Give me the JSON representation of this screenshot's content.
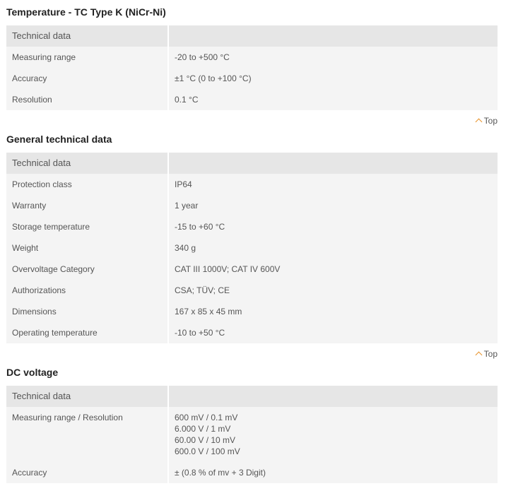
{
  "sections": [
    {
      "title": "Temperature - TC Type K (NiCr-Ni)",
      "header": {
        "label": "Technical data",
        "value": ""
      },
      "rows": [
        {
          "label": "Measuring range",
          "value": "-20 to +500 °C"
        },
        {
          "label": "Accuracy",
          "value": "±1 °C (0 to +100 °C)"
        },
        {
          "label": "Resolution",
          "value": "0.1 °C"
        }
      ],
      "top_label": "Top"
    },
    {
      "title": "General technical data",
      "header": {
        "label": "Technical data",
        "value": ""
      },
      "rows": [
        {
          "label": "Protection class",
          "value": "IP64"
        },
        {
          "label": "Warranty",
          "value": "1 year"
        },
        {
          "label": "Storage temperature",
          "value": "-15 to +60 °C"
        },
        {
          "label": "Weight",
          "value": "340 g"
        },
        {
          "label": "Overvoltage Category",
          "value": "CAT III 1000V; CAT IV 600V"
        },
        {
          "label": "Authorizations",
          "value": "CSA; TÜV; CE"
        },
        {
          "label": "Dimensions",
          "value": "167 x 85 x 45 mm"
        },
        {
          "label": "Operating temperature",
          "value": "-10 to +50 °C"
        }
      ],
      "top_label": "Top"
    },
    {
      "title": "DC voltage",
      "header": {
        "label": "Technical data",
        "value": ""
      },
      "rows": [
        {
          "label": "Measuring range / Resolution",
          "lines": [
            "600 mV / 0.1 mV",
            "6.000 V / 1 mV",
            "60.00 V / 10 mV",
            "600.0 V / 100 mV"
          ]
        },
        {
          "label": "Accuracy",
          "value": "± (0.8 % of mv + 3 Digit)"
        }
      ]
    }
  ],
  "colors": {
    "header_bg": "#e6e6e6",
    "row_bg": "#f4f4f4",
    "accent": "#e8932a"
  }
}
